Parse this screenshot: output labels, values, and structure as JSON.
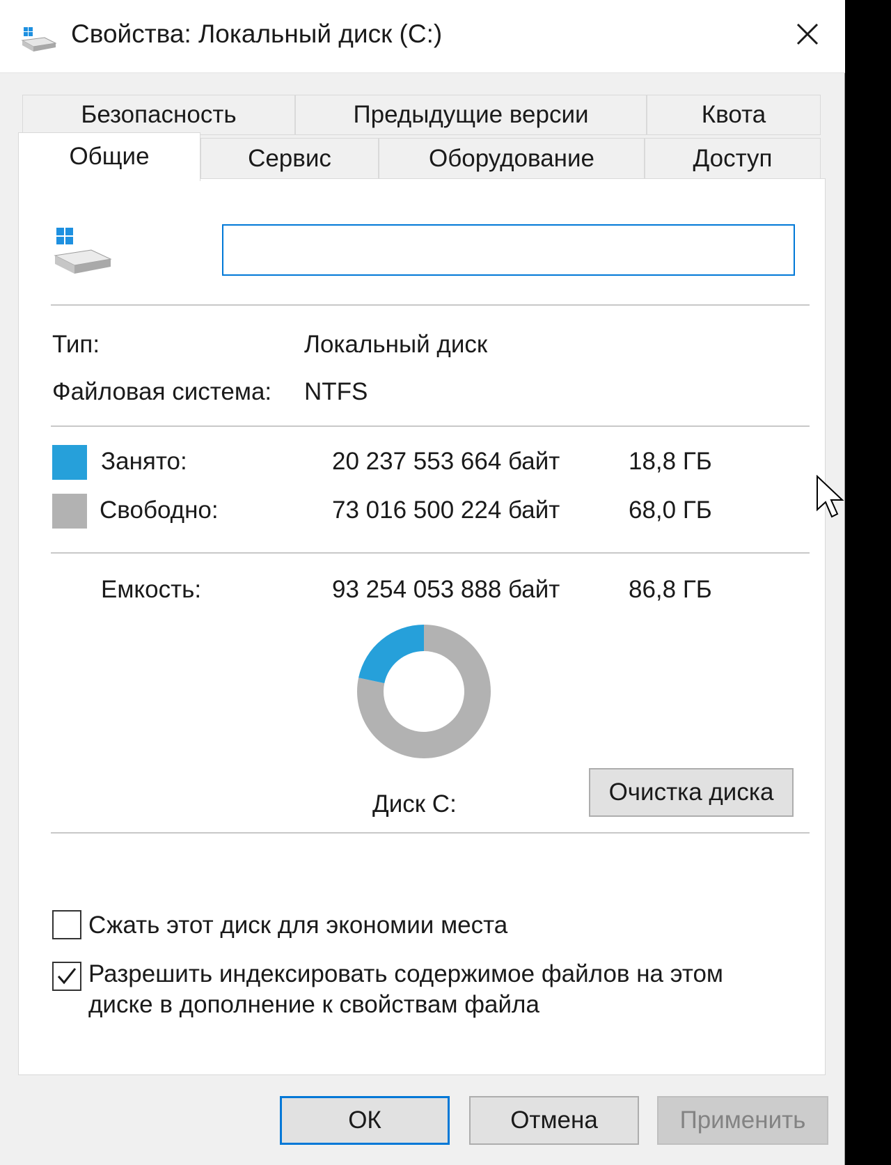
{
  "window": {
    "title": "Свойства: Локальный диск (C:)"
  },
  "tabs": {
    "row1": [
      "Безопасность",
      "Предыдущие версии",
      "Квота"
    ],
    "row2": [
      "Общие",
      "Сервис",
      "Оборудование",
      "Доступ"
    ],
    "active": "Общие"
  },
  "general": {
    "name_value": "",
    "type_label": "Тип:",
    "type_value": "Локальный диск",
    "fs_label": "Файловая система:",
    "fs_value": "NTFS",
    "used_label": "Занято:",
    "used_bytes": "20 237 553 664 байт",
    "used_gb": "18,8 ГБ",
    "free_label": "Свободно:",
    "free_bytes": "73 016 500 224 байт",
    "free_gb": "68,0 ГБ",
    "capacity_label": "Емкость:",
    "capacity_bytes": "93 254 053 888 байт",
    "capacity_gb": "86,8 ГБ",
    "disk_label": "Диск C:",
    "cleanup_button": "Очистка диска",
    "compress_label": "Сжать этот диск для экономии места",
    "compress_checked": false,
    "index_label_line1": "Разрешить индексировать содержимое файлов на этом",
    "index_label_line2": "диске в дополнение к свойствам файла",
    "index_checked": true
  },
  "usage": {
    "used_bytes": 20237553664,
    "free_bytes": 73016500224,
    "used_color": "#26a0da",
    "free_color": "#b2b2b2"
  },
  "buttons": {
    "ok": "ОК",
    "cancel": "Отмена",
    "apply": "Применить"
  },
  "colors": {
    "accent": "#0078d7",
    "window_bg": "#f0f0f0",
    "panel_bg": "#ffffff"
  },
  "icons": {
    "title": "drive-icon",
    "close": "close-icon",
    "drive": "drive-icon",
    "check": "checkmark-icon",
    "cursor": "mouse-pointer-icon"
  }
}
